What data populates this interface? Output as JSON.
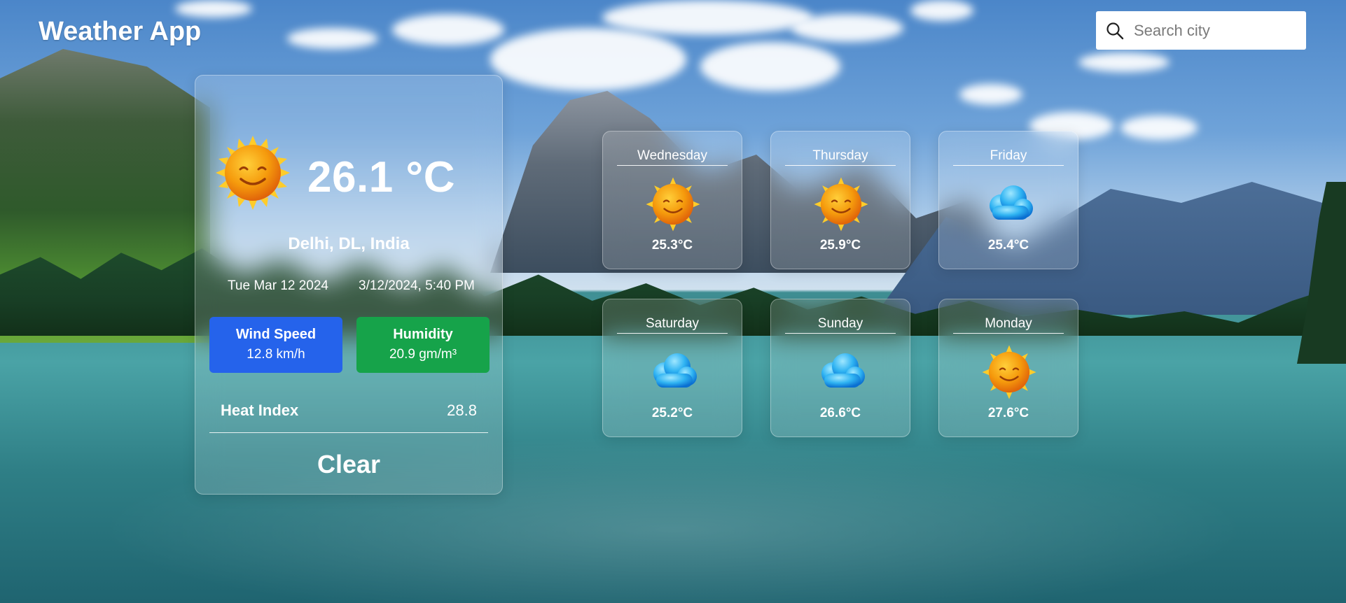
{
  "app": {
    "title": "Weather App"
  },
  "search": {
    "placeholder": "Search city",
    "value": ""
  },
  "current": {
    "icon": "sun-icon",
    "temperature": "26.1 °C",
    "location": "Delhi, DL, India",
    "date": "Tue Mar 12 2024",
    "datetime": "3/12/2024, 5:40 PM",
    "wind": {
      "label": "Wind Speed",
      "value": "12.8 km/h",
      "color": "#2563eb"
    },
    "humidity": {
      "label": "Humidity",
      "value": "20.9 gm/m³",
      "color": "#16a34a"
    },
    "heat_index": {
      "label": "Heat Index",
      "value": "28.8"
    },
    "condition": "Clear"
  },
  "forecast": [
    {
      "day": "Wednesday",
      "icon": "sun-icon",
      "temp": "25.3°C"
    },
    {
      "day": "Thursday",
      "icon": "sun-icon",
      "temp": "25.9°C"
    },
    {
      "day": "Friday",
      "icon": "cloud-icon",
      "temp": "25.4°C"
    },
    {
      "day": "Saturday",
      "icon": "cloud-icon",
      "temp": "25.2°C"
    },
    {
      "day": "Sunday",
      "icon": "cloud-icon",
      "temp": "26.6°C"
    },
    {
      "day": "Monday",
      "icon": "sun-icon",
      "temp": "27.6°C"
    }
  ]
}
